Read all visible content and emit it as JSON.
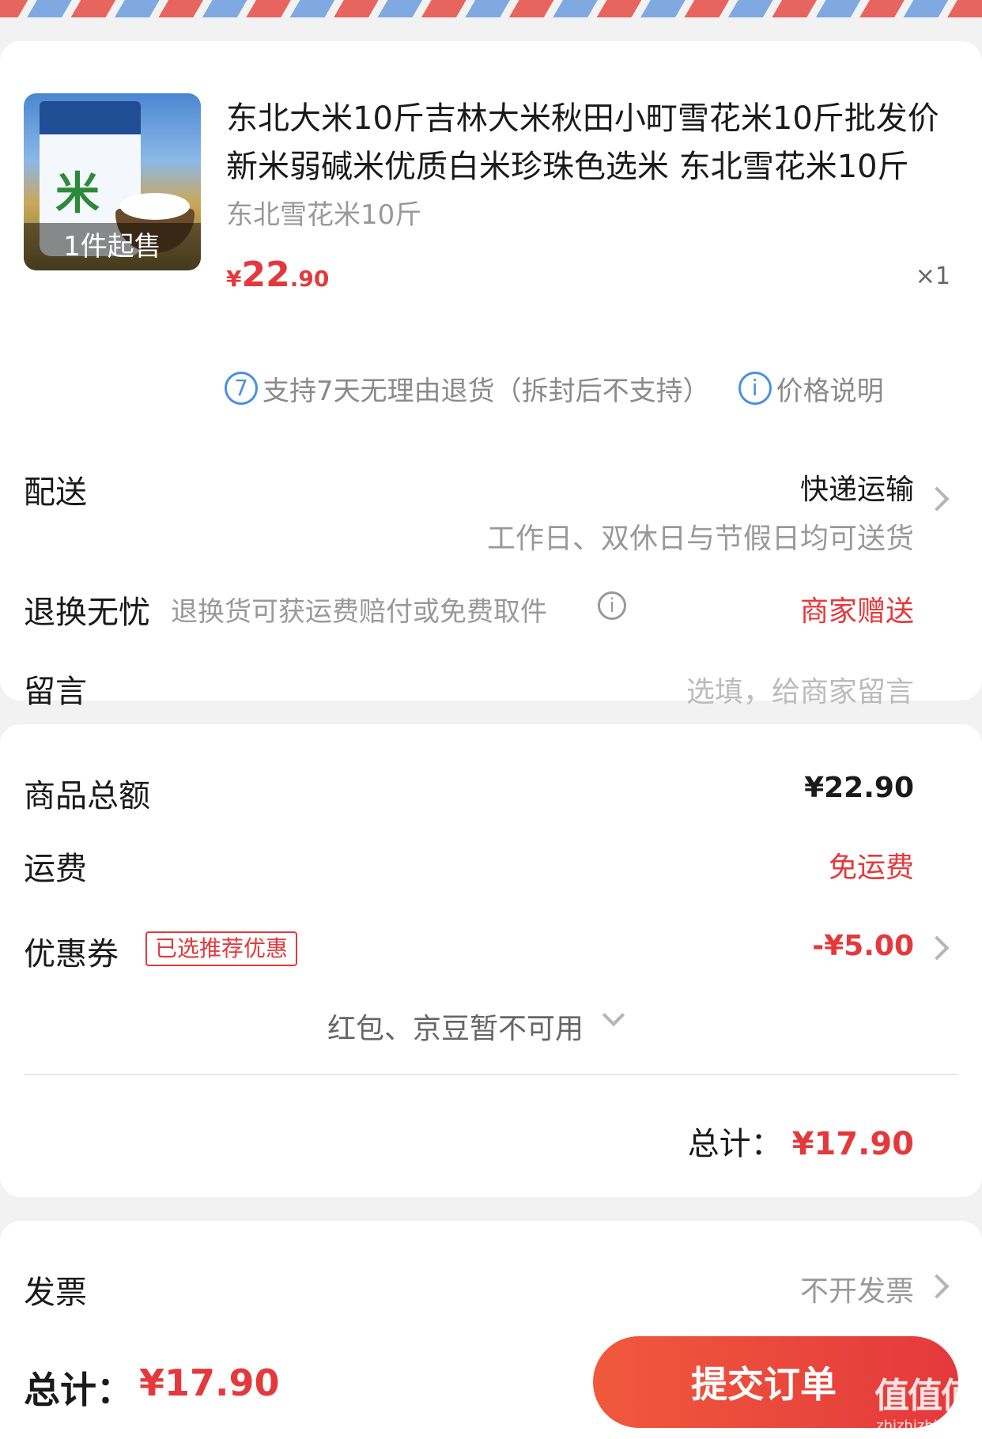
{
  "product": {
    "image_alt": "rice-bag",
    "bag_character": "米",
    "min_order_badge": "1件起售",
    "title": "东北大米10斤吉林大米秋田小町雪花米10斤批发价新米弱碱米优质白米珍珠色选米 东北雪花米10斤",
    "spec": "东北雪花米10斤",
    "price_symbol": "¥",
    "price_int": "22",
    "price_dec": ".90",
    "quantity": "×1"
  },
  "policy": {
    "return_icon": "7",
    "return_text": "支持7天无理由退货（拆封后不支持）",
    "price_icon": "i",
    "price_text": "价格说明"
  },
  "delivery": {
    "label": "配送",
    "method": "快递运输",
    "note": "工作日、双休日与节假日均可送货"
  },
  "return_worry": {
    "label": "退换无忧",
    "desc": "退换货可获运费赔付或免费取件",
    "info_icon": "i",
    "value": "商家赠送"
  },
  "message": {
    "label": "留言",
    "placeholder": "选填，给商家留言"
  },
  "summary": {
    "goods_label": "商品总额",
    "goods_value": "¥22.90",
    "shipping_label": "运费",
    "shipping_value": "免运费",
    "coupon_label": "优惠券",
    "coupon_tag": "已选推荐优惠",
    "coupon_value": "-¥5.00",
    "unavailable": "红包、京豆暂不可用",
    "total_label": "总计：",
    "total_value": "¥17.90"
  },
  "invoice": {
    "label": "发票",
    "value": "不开发票"
  },
  "bottom": {
    "total_label": "总计：",
    "total_value": "¥17.90",
    "submit": "提交订单"
  },
  "watermark": {
    "line1": "值值值",
    "line2": "zhizhizhi.com"
  },
  "colors": {
    "accent_red": "#e4393c",
    "info_blue": "#4a90e2"
  }
}
